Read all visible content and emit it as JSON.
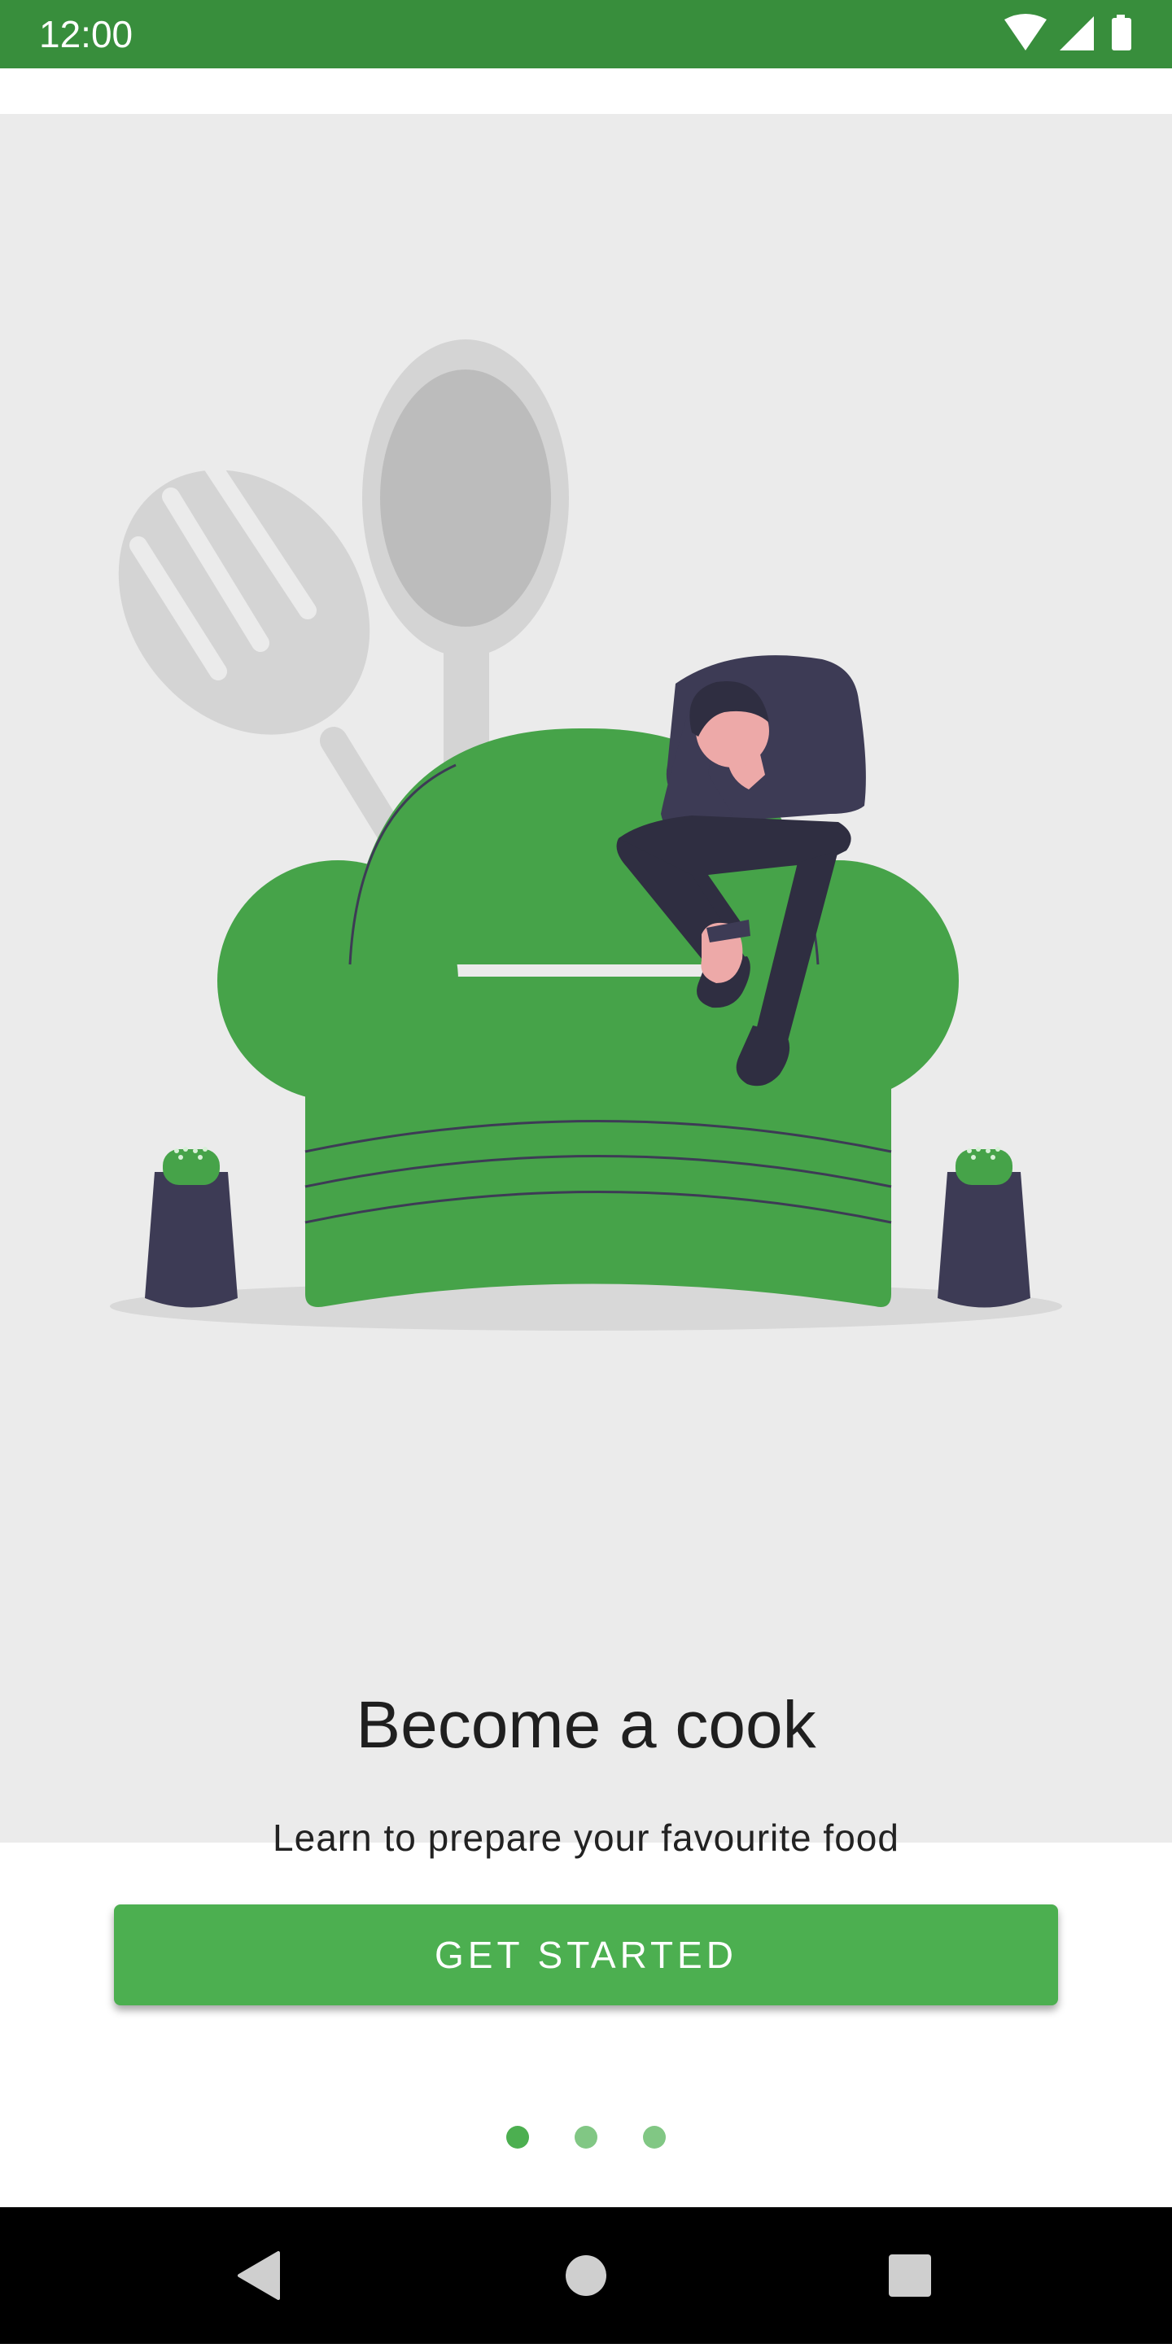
{
  "status_bar": {
    "time": "12:00",
    "icons": [
      "wifi-icon",
      "cellular-signal-icon",
      "battery-icon"
    ],
    "background": "#388e3c"
  },
  "onboarding": {
    "title": "Become a cook",
    "subtitle": "Learn to prepare your favourite food",
    "cta_label": "GET STARTED",
    "page_count": 3,
    "current_page": 1,
    "accent_color": "#4caf50"
  },
  "nav_bar": {
    "buttons": [
      "back-icon",
      "home-icon",
      "recents-icon"
    ]
  }
}
